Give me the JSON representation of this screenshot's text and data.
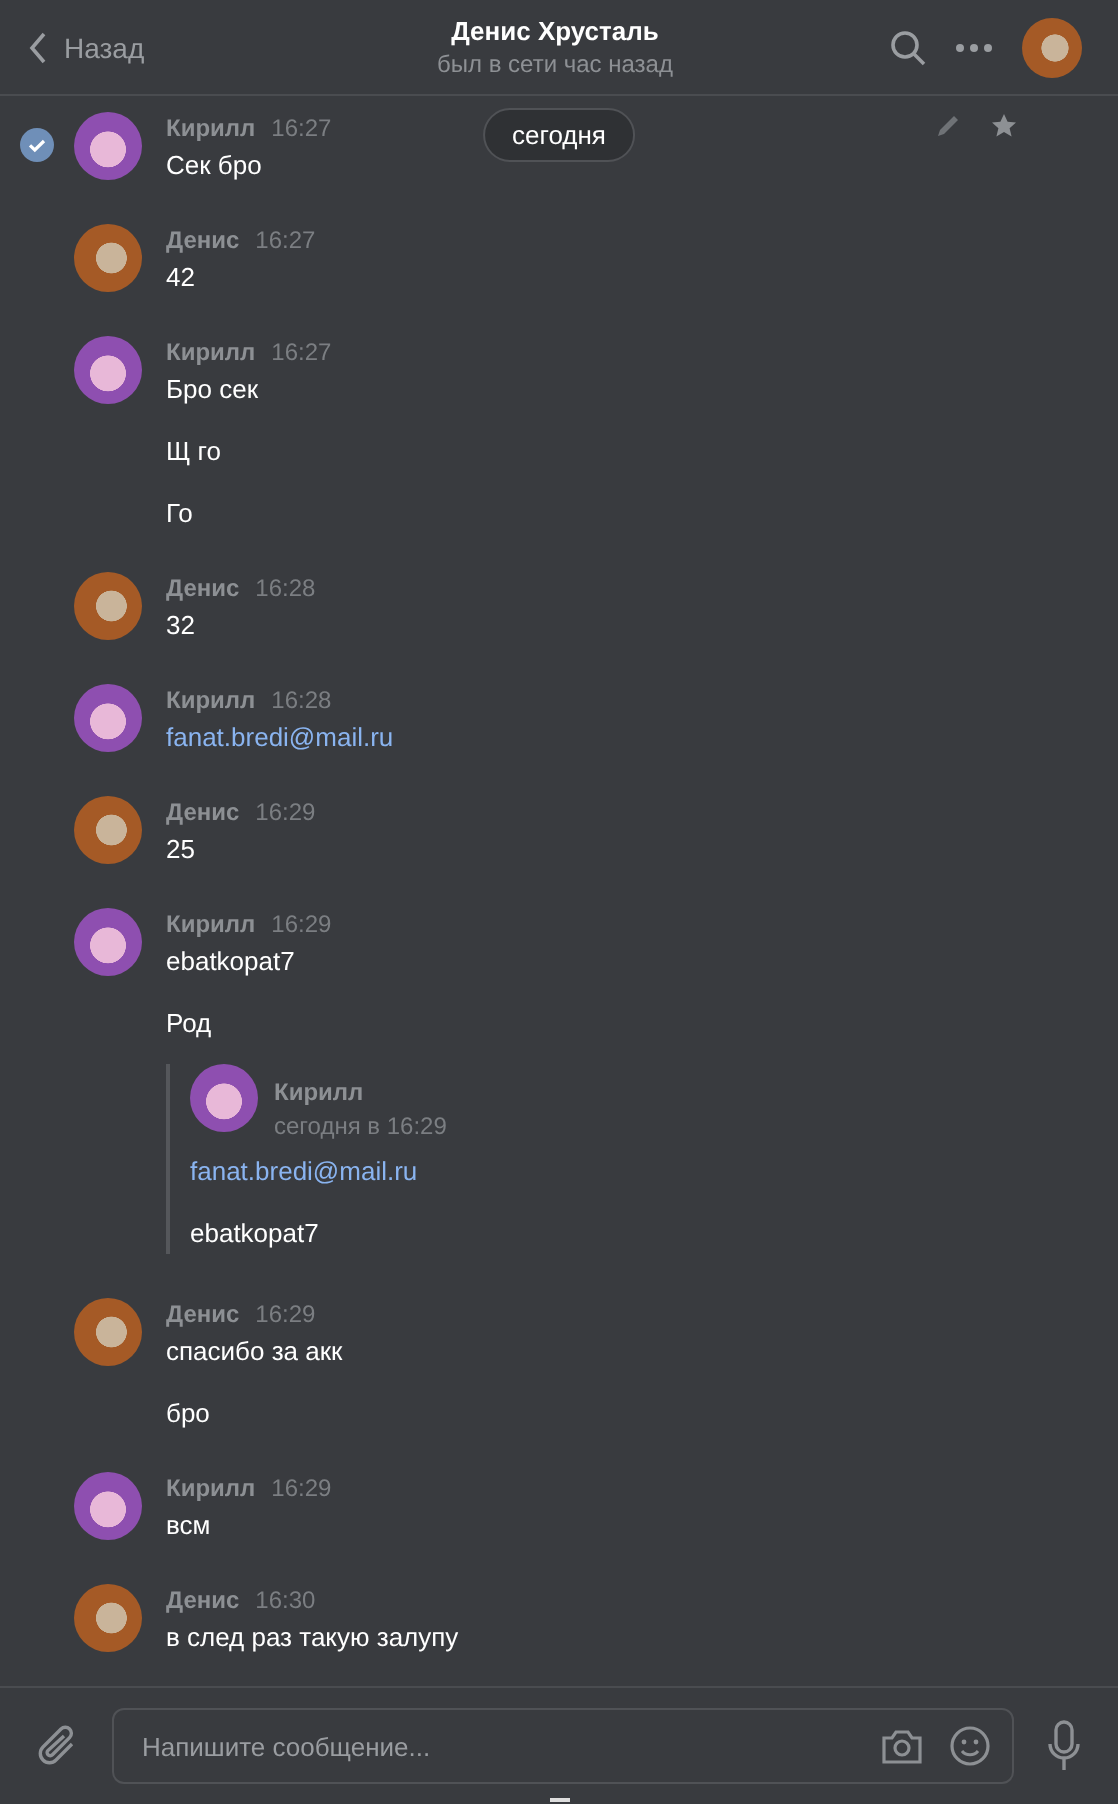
{
  "header": {
    "back_label": "Назад",
    "title": "Денис Хрусталь",
    "status": "был в сети час назад"
  },
  "date_pill": "сегодня",
  "messages": [
    {
      "author": "Кирилл",
      "time": "16:27",
      "from_me": true,
      "selected": true,
      "paragraphs": [
        {
          "kind": "text",
          "text": "Сек бро"
        }
      ]
    },
    {
      "author": "Денис",
      "time": "16:27",
      "from_me": false,
      "selected": false,
      "paragraphs": [
        {
          "kind": "text",
          "text": "42"
        }
      ]
    },
    {
      "author": "Кирилл",
      "time": "16:27",
      "from_me": true,
      "selected": false,
      "paragraphs": [
        {
          "kind": "text",
          "text": "Бро сек"
        },
        {
          "kind": "text",
          "text": "Щ го"
        },
        {
          "kind": "text",
          "text": "Го"
        }
      ]
    },
    {
      "author": "Денис",
      "time": "16:28",
      "from_me": false,
      "selected": false,
      "paragraphs": [
        {
          "kind": "text",
          "text": "32"
        }
      ]
    },
    {
      "author": "Кирилл",
      "time": "16:28",
      "from_me": true,
      "selected": false,
      "paragraphs": [
        {
          "kind": "link",
          "text": "fanat.bredi@mail.ru"
        }
      ]
    },
    {
      "author": "Денис",
      "time": "16:29",
      "from_me": false,
      "selected": false,
      "paragraphs": [
        {
          "kind": "text",
          "text": "25"
        }
      ]
    },
    {
      "author": "Кирилл",
      "time": "16:29",
      "from_me": true,
      "selected": false,
      "paragraphs": [
        {
          "kind": "text",
          "text": "ebatkopat7"
        },
        {
          "kind": "text",
          "text": "Род"
        },
        {
          "kind": "quote",
          "author": "Кирилл",
          "time": "сегодня в 16:29",
          "from_me": true,
          "paragraphs": [
            {
              "kind": "link",
              "text": "fanat.bredi@mail.ru"
            },
            {
              "kind": "text",
              "text": "ebatkopat7"
            }
          ]
        }
      ]
    },
    {
      "author": "Денис",
      "time": "16:29",
      "from_me": false,
      "selected": false,
      "paragraphs": [
        {
          "kind": "text",
          "text": "спасибо за акк"
        },
        {
          "kind": "text",
          "text": "бро"
        }
      ]
    },
    {
      "author": "Кирилл",
      "time": "16:29",
      "from_me": true,
      "selected": false,
      "paragraphs": [
        {
          "kind": "text",
          "text": "всм"
        }
      ]
    },
    {
      "author": "Денис",
      "time": "16:30",
      "from_me": false,
      "selected": false,
      "paragraphs": [
        {
          "kind": "text",
          "text": "в след раз такую залупу"
        }
      ]
    }
  ],
  "composer": {
    "placeholder": "Напишите сообщение..."
  }
}
